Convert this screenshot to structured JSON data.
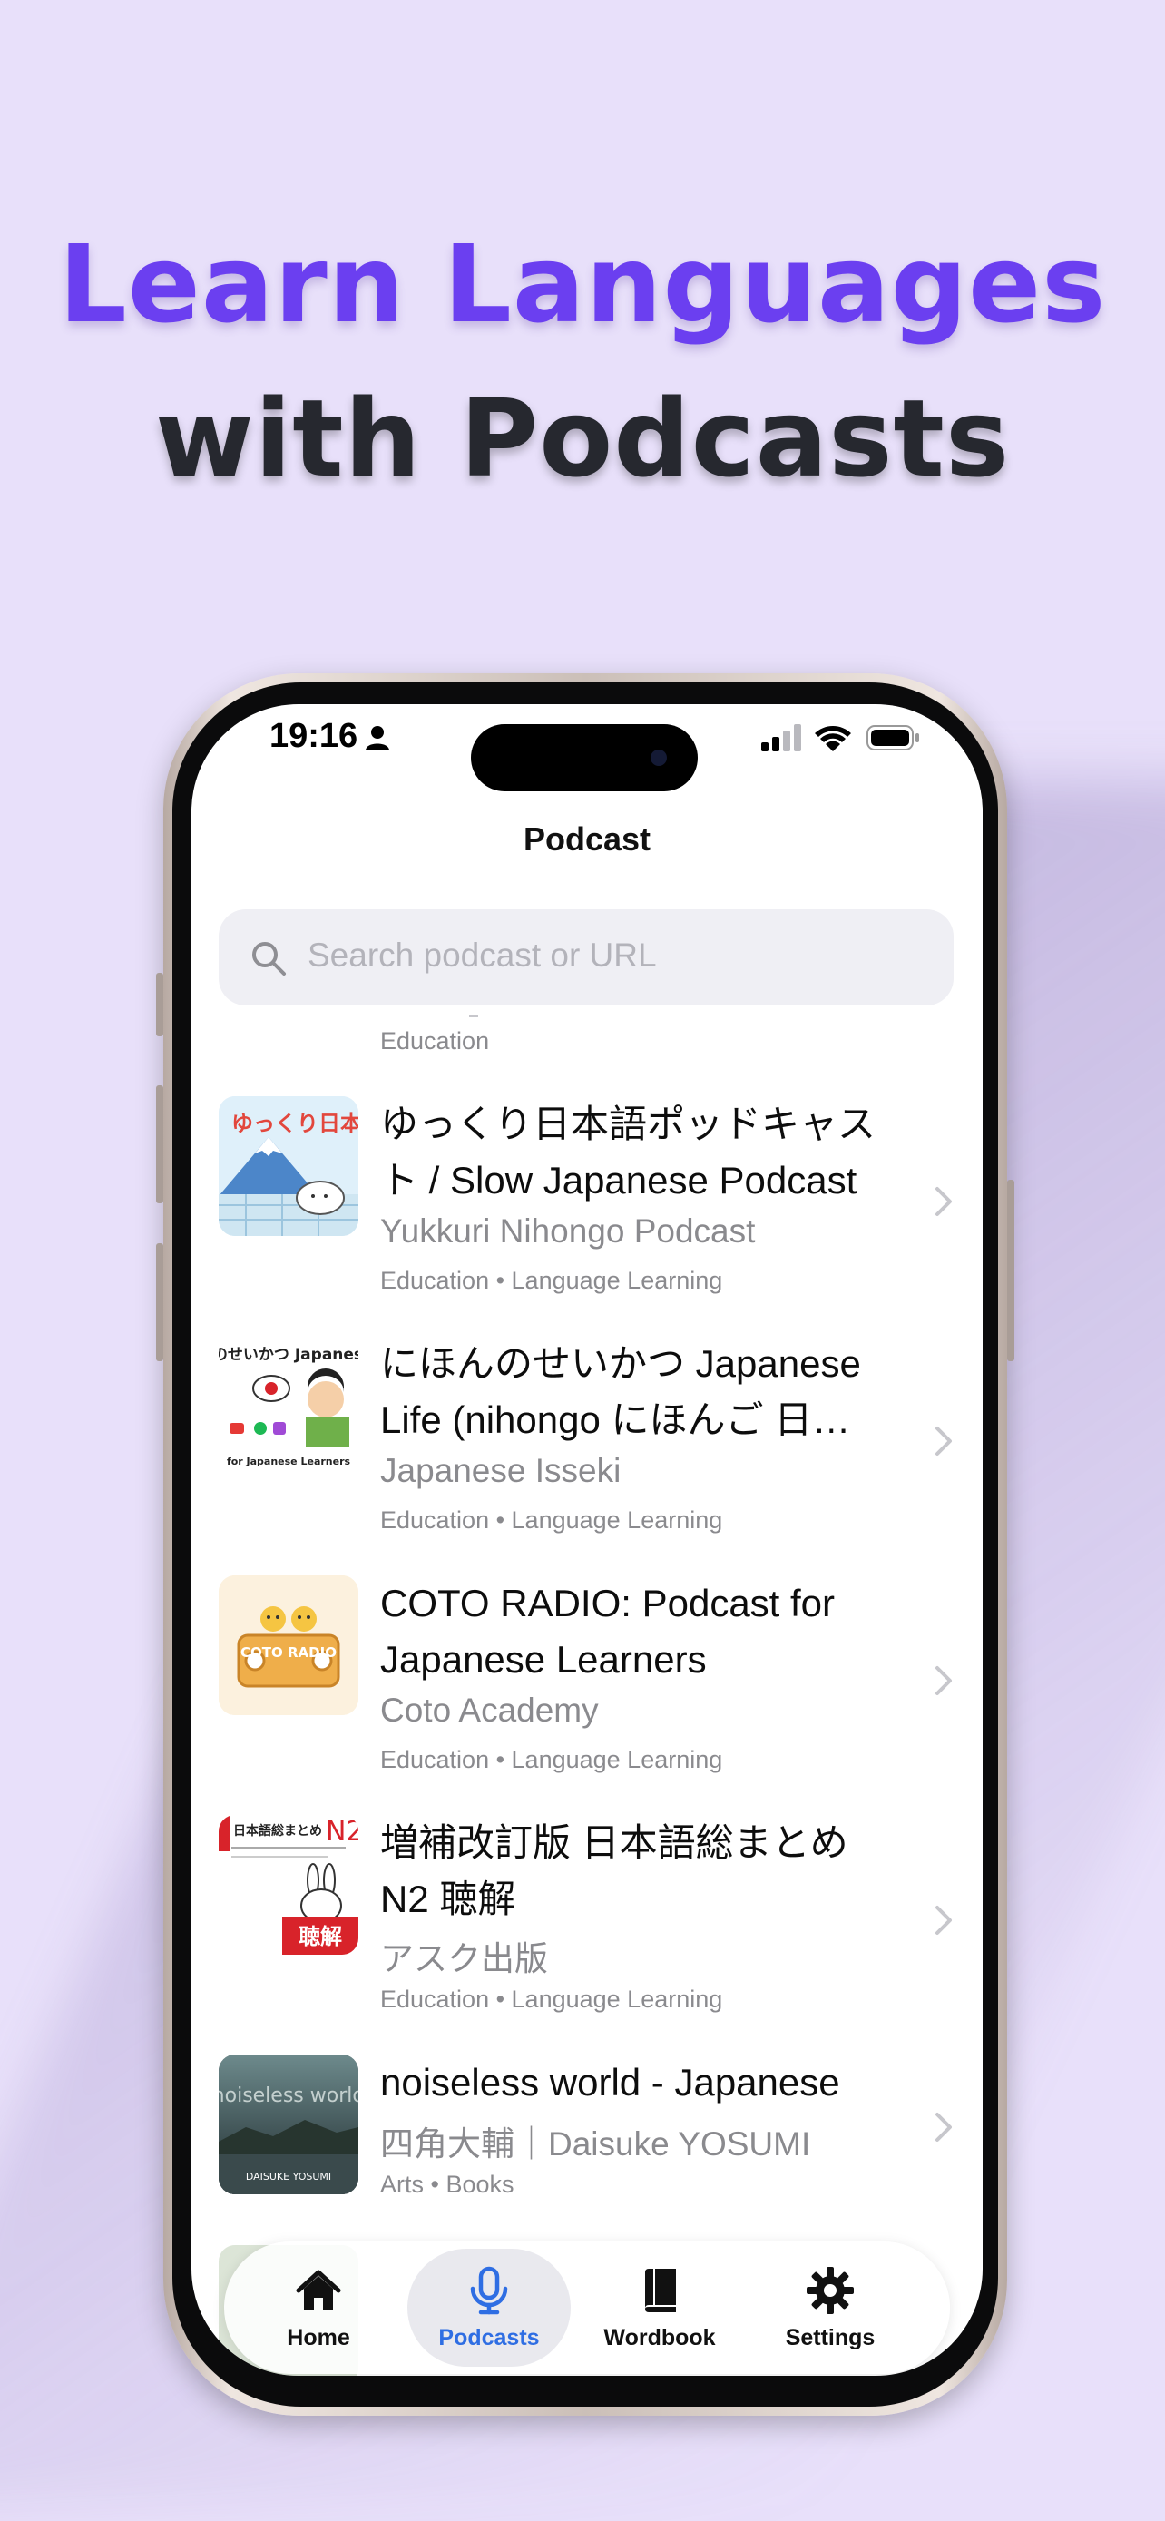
{
  "headline": {
    "line1": "Learn Languages",
    "line2": "with Podcasts"
  },
  "status_bar": {
    "time": "19:16"
  },
  "nav": {
    "title": "Podcast"
  },
  "search": {
    "placeholder": "Search podcast or URL"
  },
  "previous_row_categories": "Education",
  "podcasts": [
    {
      "title": "ゆっくり日本語ポッドキャスト / Slow Japanese Podcast",
      "author": "Yukkuri Nihongo Podcast",
      "categories": "Education • Language Learning",
      "art_text": "ゆっくり日本語"
    },
    {
      "title": "にほんのせいかつ Japanese Life (nihongo にほんご 日本語)",
      "author": "Japanese Isseki",
      "categories": "Education • Language Learning",
      "art_text": "にほんのせいかつ Japanese Life"
    },
    {
      "title": "COTO RADIO: Podcast for Japanese Learners",
      "author": "Coto Academy",
      "categories": "Education • Language Learning",
      "art_text": "COTO RADIO"
    },
    {
      "title": "増補改訂版 日本語総まとめ N2 聴解",
      "author": "アスク出版",
      "categories": "Education • Language Learning",
      "art_text": "聴解"
    },
    {
      "title": "noiseless world - Japanese",
      "author": "四角大輔｜Daisuke YOSUMI",
      "categories": "Arts • Books",
      "art_text": "noiseless world"
    }
  ],
  "tabs": [
    {
      "label": "Home",
      "icon": "house-icon",
      "active": false
    },
    {
      "label": "Podcasts",
      "icon": "microphone-icon",
      "active": true
    },
    {
      "label": "Wordbook",
      "icon": "book-icon",
      "active": false
    },
    {
      "label": "Settings",
      "icon": "gear-icon",
      "active": false
    }
  ],
  "colors": {
    "background": "#e8e0fa",
    "headline_accent": "#6b3ff0",
    "headline_dark": "#26282f",
    "tab_active": "#2f6ee3"
  }
}
